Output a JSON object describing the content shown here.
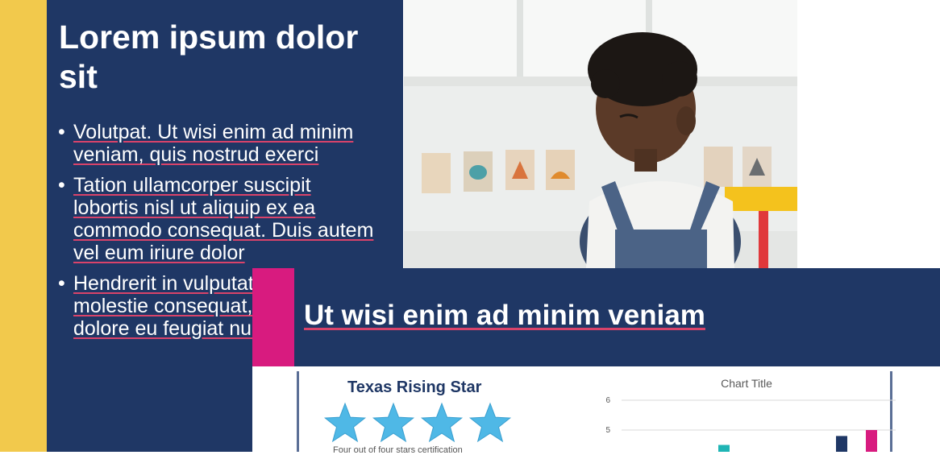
{
  "back_slide": {
    "title": "Lorem ipsum dolor sit",
    "bullets": [
      "Volutpat. Ut wisi enim ad minim veniam, quis nostrud exerci",
      "Tation ullamcorper suscipit lobortis nisl ut aliquip ex ea commodo consequat. Duis autem vel eum iriure dolor",
      "Hendrerit in vulputate velit esse molestie consequat, vel illum dolore eu feugiat nulla facilisis"
    ]
  },
  "front_slide": {
    "title": "Ut wisi enim ad minim veniam",
    "texas_rising_star": {
      "title": "Texas Rising Star",
      "stars": 4,
      "caption": "Four out of four stars certification"
    }
  },
  "colors": {
    "navy": "#1f3765",
    "yellow": "#f2c94c",
    "magenta": "#d81b7f",
    "star_blue": "#4fb8e6",
    "teal": "#1fb5b5"
  },
  "chart_data": {
    "type": "bar",
    "title": "Chart Title",
    "ytick_labels": [
      "6",
      "5"
    ],
    "ylim": [
      0,
      6
    ],
    "series": [
      {
        "color": "#1fb5b5",
        "values": [
          4.5
        ]
      },
      {
        "color": "#1f3765",
        "values": [
          4.8
        ]
      },
      {
        "color": "#d81b7f",
        "values": [
          5.0
        ]
      }
    ],
    "grid": true
  }
}
